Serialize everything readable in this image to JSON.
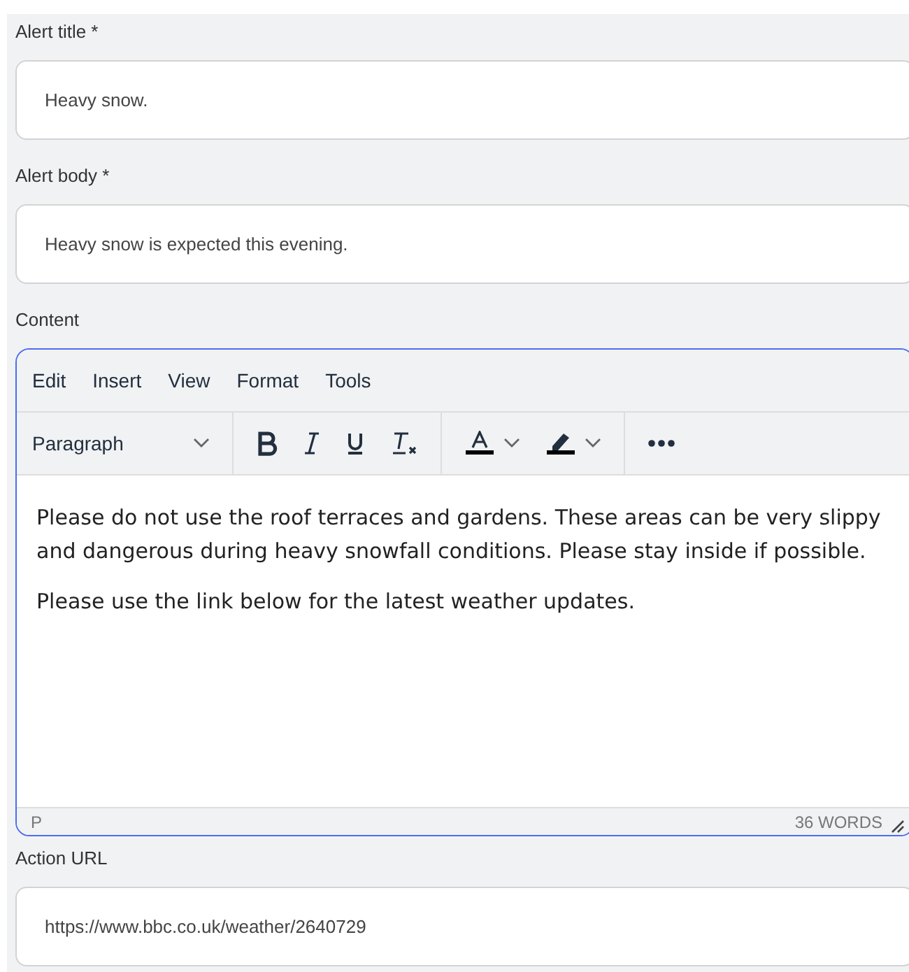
{
  "fields": [
    {
      "label": "Alert title *",
      "value": "Heavy snow."
    },
    {
      "label": "Alert body *",
      "value": "Heavy snow is expected this evening."
    }
  ],
  "editor": {
    "label": "Content",
    "focused": true,
    "menu": [
      "Edit",
      "Insert",
      "View",
      "Format",
      "Tools"
    ],
    "block_format": "Paragraph",
    "paragraphs": [
      "Please do not use the roof terraces and gardens. These areas can be very slippy and dangerous during heavy snowfall conditions. Please stay inside if possible.",
      "Please use the link below for the latest weather updates."
    ],
    "path": "P",
    "word_count": "36 WORDS"
  },
  "action_url": {
    "label": "Action URL",
    "value": "https://www.bbc.co.uk/weather/2640729"
  }
}
